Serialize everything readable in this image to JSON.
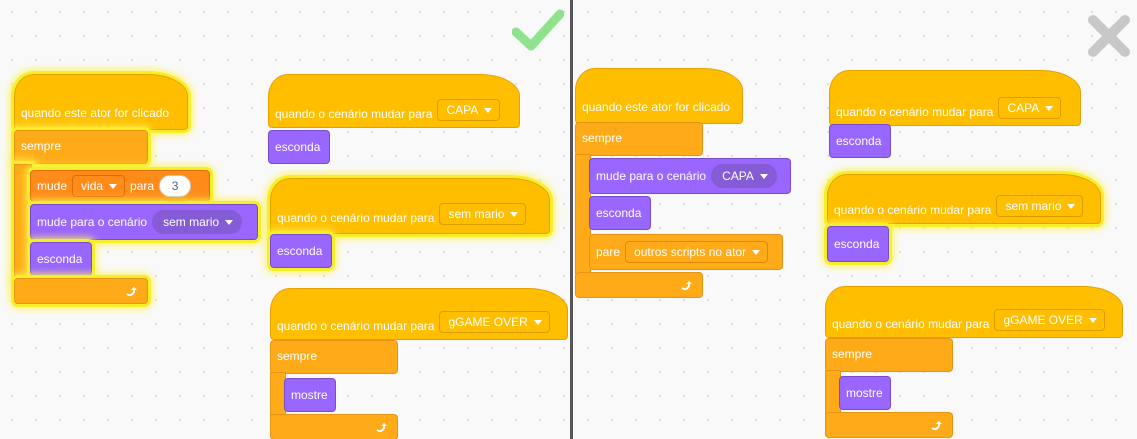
{
  "icons": {
    "correct": "checkmark-icon",
    "wrong": "x-mark-icon",
    "loop": "loop-arrow-icon",
    "dropdown": "caret-down-icon"
  },
  "colors": {
    "events": "#FFBF00",
    "control": "#FFAB19",
    "looks": "#9966FF",
    "variables": "#FF8C1A",
    "highlight": "#F5EE2A",
    "check": "#8FE38F",
    "cross": "#C8C8C8"
  },
  "left": {
    "script1": {
      "hat": "quando este ator for clicado",
      "forever": "sempre",
      "set_prefix": "mude",
      "set_var": "vida",
      "set_mid": "para",
      "set_value": "3",
      "switch_label": "mude para o cenário",
      "switch_value": "sem mario",
      "hide": "esconda"
    },
    "script2": {
      "hat": "quando o cenário mudar para",
      "value": "CAPA",
      "hide": "esconda"
    },
    "script3": {
      "hat": "quando o cenário mudar para",
      "value": "sem mario",
      "hide": "esconda"
    },
    "script4": {
      "hat": "quando o cenário mudar para",
      "value": "gGAME OVER",
      "forever": "sempre",
      "show": "mostre"
    }
  },
  "right": {
    "script1": {
      "hat": "quando este ator for clicado",
      "forever": "sempre",
      "switch_label": "mude para o cenário",
      "switch_value": "CAPA",
      "hide": "esconda",
      "stop_label": "pare",
      "stop_value": "outros scripts no ator"
    },
    "script2": {
      "hat": "quando o cenário mudar para",
      "value": "CAPA",
      "hide": "esconda"
    },
    "script3": {
      "hat": "quando o cenário mudar para",
      "value": "sem mario",
      "hide": "esconda"
    },
    "script4": {
      "hat": "quando o cenário mudar para",
      "value": "gGAME OVER",
      "forever": "sempre",
      "show": "mostre"
    }
  }
}
